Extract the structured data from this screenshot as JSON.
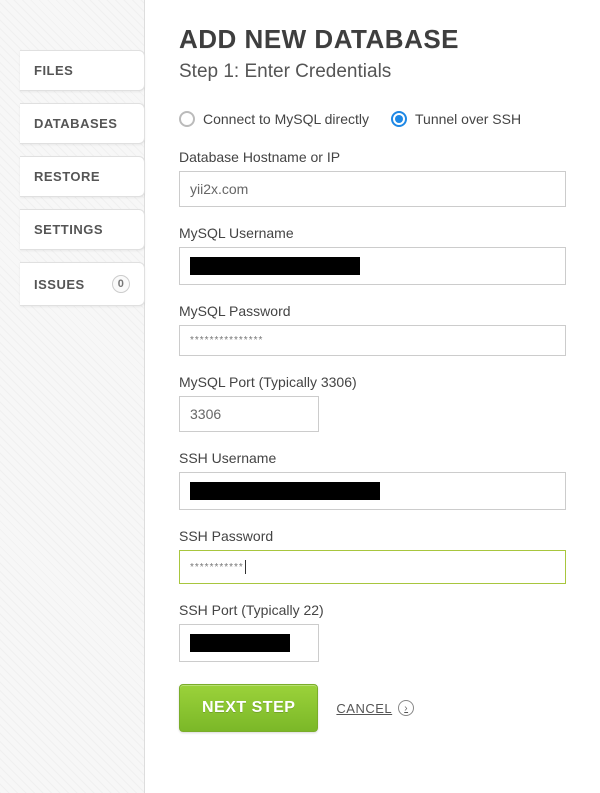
{
  "sidebar": {
    "items": [
      {
        "label": "FILES"
      },
      {
        "label": "DATABASES"
      },
      {
        "label": "RESTORE"
      },
      {
        "label": "SETTINGS"
      },
      {
        "label": "ISSUES",
        "badge": "0"
      }
    ]
  },
  "header": {
    "title": "ADD NEW DATABASE",
    "subtitle": "Step 1: Enter Credentials"
  },
  "connection": {
    "direct_label": "Connect to MySQL directly",
    "ssh_label": "Tunnel over SSH",
    "selected": "ssh"
  },
  "fields": {
    "db_host": {
      "label": "Database Hostname or IP",
      "value": "yii2x.com"
    },
    "mysql_user": {
      "label": "MySQL Username",
      "redacted": true
    },
    "mysql_pass": {
      "label": "MySQL Password",
      "masked": "***************"
    },
    "mysql_port": {
      "label": "MySQL Port (Typically 3306)",
      "value": "3306"
    },
    "ssh_user": {
      "label": "SSH Username",
      "redacted": true
    },
    "ssh_pass": {
      "label": "SSH Password",
      "masked": "***********",
      "focused": true
    },
    "ssh_port": {
      "label": "SSH Port (Typically 22)",
      "redacted": true
    }
  },
  "actions": {
    "next_label": "NEXT STEP",
    "cancel_label": "CANCEL"
  }
}
